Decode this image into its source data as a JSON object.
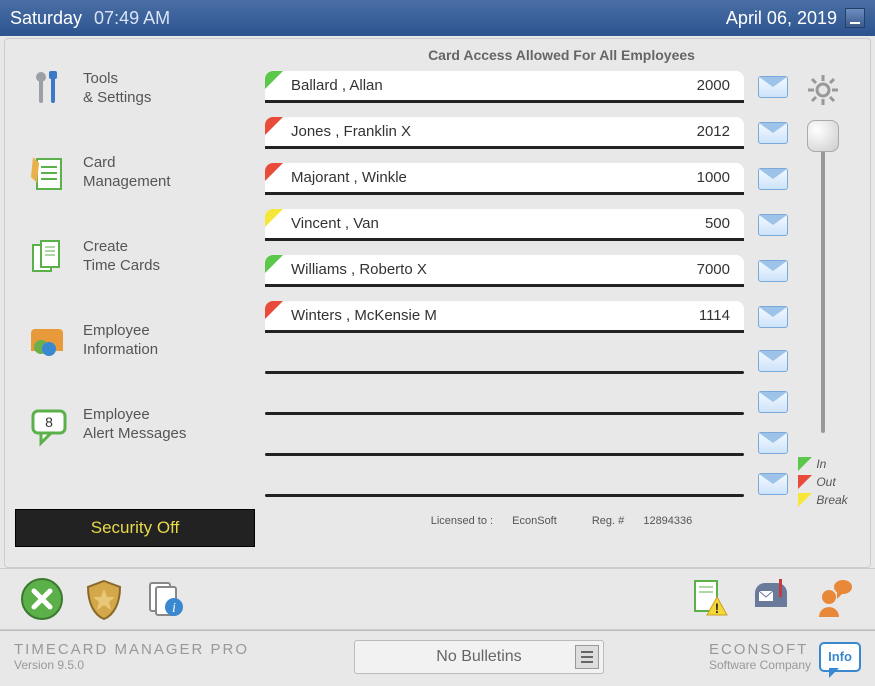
{
  "titlebar": {
    "day": "Saturday",
    "time": "07:49 AM",
    "date": "April 06, 2019"
  },
  "sidebar": {
    "items": [
      {
        "line1": "Tools",
        "line2": "& Settings"
      },
      {
        "line1": "Card",
        "line2": "Management"
      },
      {
        "line1": "Create",
        "line2": "Time Cards"
      },
      {
        "line1": "Employee",
        "line2": "Information"
      },
      {
        "line1": "Employee",
        "line2": "Alert Messages",
        "badge": "8"
      }
    ],
    "security": "Security Off"
  },
  "card_panel": {
    "header": "Card Access Allowed For All Employees",
    "rows": [
      {
        "name": "Ballard , Allan",
        "num": "2000",
        "status": "in"
      },
      {
        "name": "Jones , Franklin X",
        "num": "2012",
        "status": "out"
      },
      {
        "name": "Majorant , Winkle",
        "num": "1000",
        "status": "out"
      },
      {
        "name": "Vincent , Van",
        "num": "500",
        "status": "brk"
      },
      {
        "name": "Williams , Roberto X",
        "num": "7000",
        "status": "in"
      },
      {
        "name": "Winters , McKensie M",
        "num": "1114",
        "status": "out"
      }
    ],
    "legend": {
      "in": "In",
      "out": "Out",
      "brk": "Break"
    }
  },
  "license": {
    "licensed_to_label": "Licensed to : ",
    "licensed_to": "EconSoft",
    "reg_label": "Reg. # ",
    "reg": "12894336"
  },
  "footer": {
    "product": "TIMECARD MANAGER PRO",
    "version": "Version 9.5.0",
    "bulletin": "No Bulletins",
    "company": "ECONSOFT",
    "company_sub": "Software Company",
    "info": "Info"
  }
}
